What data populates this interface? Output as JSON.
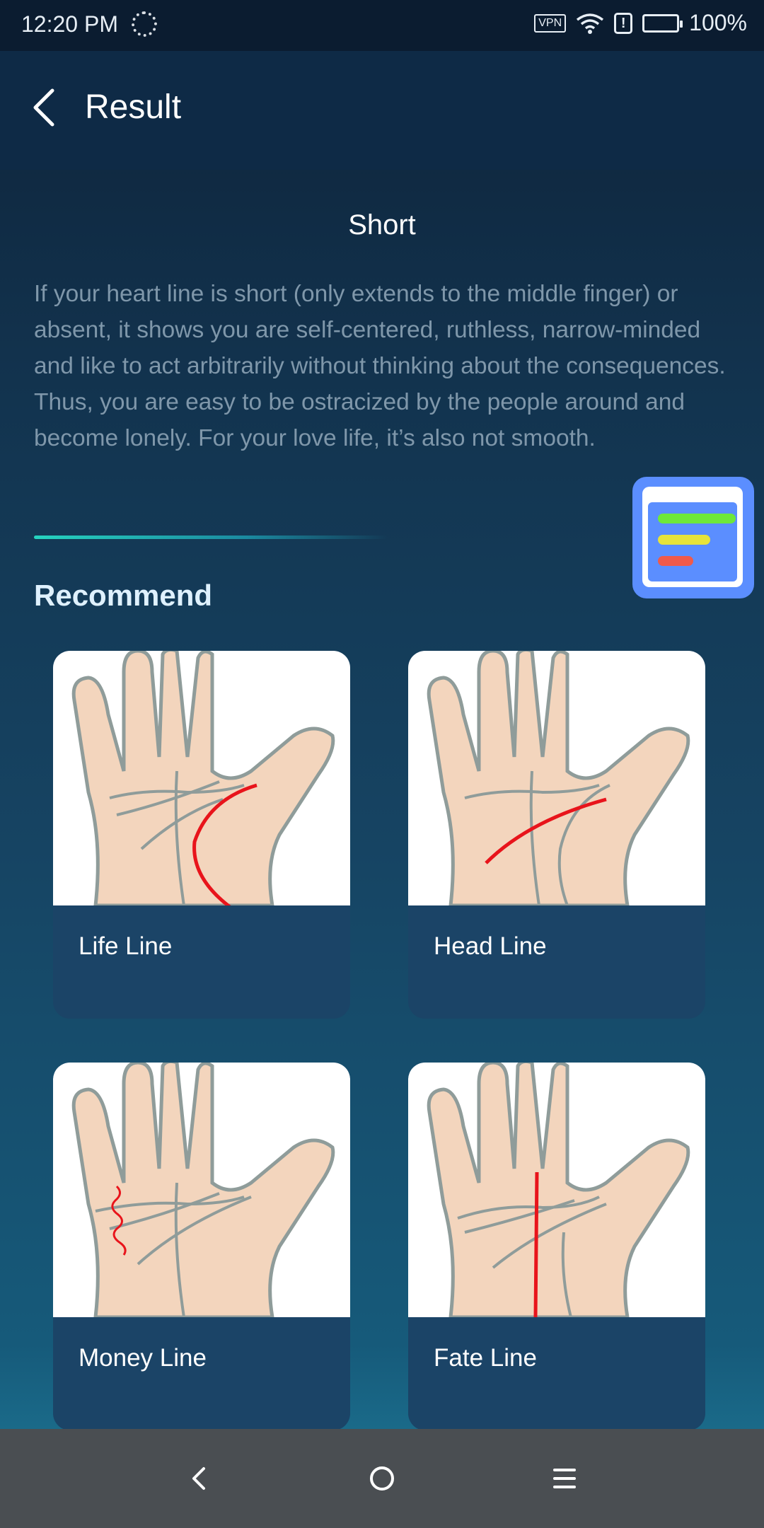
{
  "status_bar": {
    "time": "12:20 PM",
    "vpn": "VPN",
    "alert": "!",
    "battery": "100%",
    "battery_level": 1.0
  },
  "app_bar": {
    "title": "Result",
    "back_icon": "chevron-left-icon"
  },
  "result": {
    "heading": "Short",
    "description": "If your heart line is short (only extends to the middle finger) or absent, it shows you are self-centered, ruthless, narrow-minded and like to act arbitrarily without thinking about the consequences. Thus, you are easy to be ostracized by the people around and become lonely. For your love life, it’s also not smooth."
  },
  "recommend": {
    "title": "Recommend",
    "items": [
      {
        "label": "Life Line",
        "icon": "palm-life-line-image"
      },
      {
        "label": "Head Line",
        "icon": "palm-head-line-image"
      },
      {
        "label": "Money Line",
        "icon": "palm-money-line-image"
      },
      {
        "label": "Fate Line",
        "icon": "palm-fate-line-image"
      }
    ]
  },
  "floating_button": {
    "icon": "report-list-icon",
    "colors": [
      "#6ee83a",
      "#e7e33a",
      "#f05a4a"
    ]
  },
  "nav_bar": {
    "back_icon": "nav-back-icon",
    "home_icon": "nav-home-icon",
    "menu_icon": "nav-menu-icon"
  },
  "colors": {
    "accent": "#26d3c0",
    "line_red": "#e8141b",
    "float_blue": "#5b8eff"
  }
}
